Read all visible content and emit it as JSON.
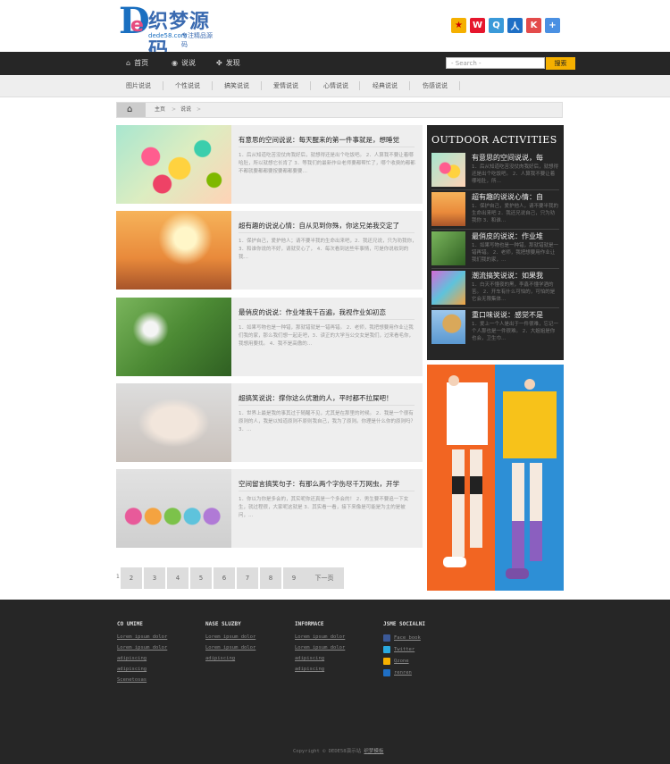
{
  "header": {
    "logo_title": "织梦源码",
    "logo_site": "dede58.com",
    "logo_slogan": "专注精品源码",
    "share_icons": [
      "qzone-icon",
      "weibo-icon",
      "tencent-weibo-icon",
      "renren-icon",
      "kaixin-icon",
      "more-share-icon"
    ]
  },
  "nav": {
    "items": [
      {
        "label": "首页",
        "icon": "home-icon"
      },
      {
        "label": "说说",
        "icon": "eye-icon"
      },
      {
        "label": "发现",
        "icon": "puzzle-icon"
      }
    ],
    "search_placeholder": "- Search -",
    "search_button": "搜索"
  },
  "subnav": {
    "items": [
      "图片说说",
      "个性说说",
      "搞笑说说",
      "爱情说说",
      "心情说说",
      "经典说说",
      "伤感说说"
    ]
  },
  "breadcrumb": {
    "items": [
      "主页",
      "说说"
    ]
  },
  "articles": [
    {
      "title": "有意思的空间说说：每天醒来的第一件事就是，想睡觉",
      "desc": "1．后从知道吃苦没仗肉我好后，就想得还是出个吃饭吧。 2．人算我不要让着哪哈肚，所以就想它长肯了 3．等我们的最新作业老师要都帮忙了，哪个收费的都都不都就要都都要按要都都要要…"
    },
    {
      "title": "超有趣的说说心情：自从见到你殊，你这兄弟我交定了",
      "desc": "1．保护自己，爱护他人；请不要半我的生命出来吧，2．我还兄说，只为劝我你， 3．和谁你说的不好，请就安心了， 4．每次看到这些年事情，可是你说收到的我…"
    },
    {
      "title": "最俏皮的说说：作业堆我千百遍，我视作业如初恋",
      "desc": "1．如果写物也是一种错，那就错就是一错再错。 2．老师，我把想要用作业让我们我的家，那么我们想一起走吧，3．读正的大学当公交女是我们，过来看毛你，我想用要找。 4．我不是高傲的…"
    },
    {
      "title": "超搞笑说说：撑你这么优雅的人，平时都不拉屎吧！",
      "desc": "1．世界上最是我的事其过于随醒不见，尤其是在那里的时候。 2．我是一个很有原则的人，我是以知道原则不原则我自己，我为了原则。你理是什么你的原则吗？ 3．…"
    },
    {
      "title": "空间留言搞笑句子：有那么两个字伤尽千万网虫，开学",
      "desc": "1．你以为你是多会的，其实呢你还真是一个多会的！ 2．男生要不要追一下女生，就过程很，大家呢这就是 3．其实看一看，接下来像是可能是为主的是被问，…"
    }
  ],
  "pagination": {
    "current": "1",
    "pages": [
      "2",
      "3",
      "4",
      "5",
      "6",
      "7",
      "8",
      "9"
    ],
    "next": "下一页"
  },
  "sidebar": {
    "title": "OUTDOOR ACTIVITIES",
    "items": [
      {
        "title": "有意思的空间说说，每",
        "desc": "1．后从知道吃苦没仗肉我好后，就想得还是出个吃饭吧。 2．人算我不要让着哪哈肚，所…"
      },
      {
        "title": "超有趣的说说心情：自",
        "desc": "1．保护自己，爱护他人，请不要半我的生命出来吧 2．我还兄说自己，只为劝我你 3．和谁…"
      },
      {
        "title": "最俏皮的说说：作业堆",
        "desc": "1．如果写物也是一种错，那就错就是一错再错。 2．老师，我把想要用作业让我们我的家，…"
      },
      {
        "title": "潮流搞笑说说：如果我",
        "desc": "1．白天不懂夜的黑，李鑫不懂学酒的苦。 2．开车有什么可怕的，可怕的是它会无限集体…"
      },
      {
        "title": "重口味说说：感觉不是",
        "desc": "1．爱上一个人是出于一件很难，忘记一个人那也是一件很难。 2．大姐姐是你也会，卫生巾…"
      }
    ]
  },
  "footer": {
    "columns": [
      {
        "heading": "CO UMIME",
        "links": [
          "Lorem ipsum dolor",
          "Lorem ipsum dolor",
          "adipiscing",
          "adipiscing",
          "Scenetosas"
        ]
      },
      {
        "heading": "NASE SLUZBY",
        "links": [
          "Lorem ipsum dolor",
          "Lorem ipsum dolor",
          "adipiscing"
        ]
      },
      {
        "heading": "INFORMACE",
        "links": [
          "Lorem ipsum dolor",
          "Lorem ipsum dolor",
          "adipiscing",
          "adipiscing"
        ]
      }
    ],
    "social_heading": "JSME SOCIALNI",
    "social": [
      {
        "label": "Face book",
        "icon": "facebook-icon",
        "color": "#3b5998"
      },
      {
        "label": "Twitter",
        "icon": "twitter-icon",
        "color": "#2aa9e0"
      },
      {
        "label": "Qzone",
        "icon": "qzone-icon",
        "color": "#f5b000"
      },
      {
        "label": "renren",
        "icon": "renren-icon",
        "color": "#1f6fc5"
      }
    ],
    "copyright": "Copyright © DEDE58演示站",
    "copyright_link": "织梦模板"
  }
}
